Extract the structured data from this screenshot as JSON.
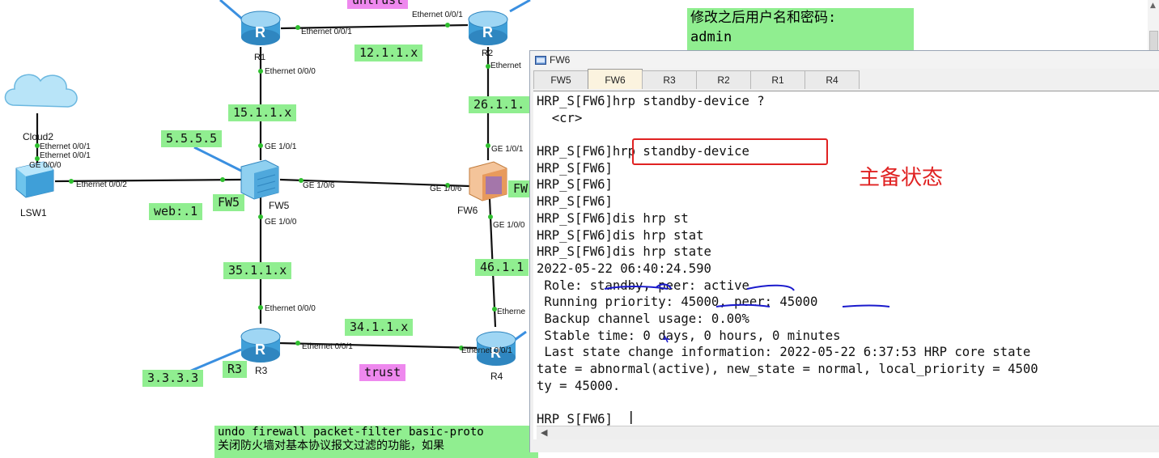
{
  "topology": {
    "devices": {
      "r1": "R1",
      "r2": "R2",
      "r3": "R3",
      "r4": "R4",
      "fw5": "FW5",
      "fw6": "FW6",
      "lsw1": "LSW1",
      "cloud2": "Cloud2"
    },
    "ports": {
      "r1_e001": "Ethernet 0/0/1",
      "r1_e000": "Ethernet 0/0/0",
      "r2_e001": "Ethernet 0/0/1",
      "r2_e": "Ethernet",
      "cloud_e1a": "Ethernet 0/0/1",
      "cloud_e1b": "Ethernet 0/0/1",
      "lsw_ge": "GE 0/0/0",
      "lsw_e2": "Ethernet 0/0/2",
      "fw5_g101": "GE 1/0/1",
      "fw5_g106": "GE 1/0/6",
      "fw5_g100": "GE 1/0/0",
      "fw6_g101": "GE 1/0/1",
      "fw6_g106": "GE 1/0/6",
      "fw6_g100": "GE 1/0/0",
      "r3_e000": "Ethernet 0/0/0",
      "r3_e001": "Ethernet 0/0/1",
      "r4_e001": "Ethernet 0/0/1",
      "r4_e": "Etherne"
    },
    "notes": {
      "untrust": "untrust",
      "net12": "12.1.1.x",
      "net15": "15.1.1.x",
      "net26": "26.1.1.",
      "n5555": "5.5.5.5",
      "fw5": "FW5",
      "fw6": "FW",
      "web": "web:.1",
      "net35": "35.1.1.x",
      "net46": "46.1.1",
      "net34": "34.1.1.x",
      "n3333": "3.3.3.3",
      "r3": "R3",
      "trust": "trust"
    },
    "textbox_line1": "修改之后用户名和密码:",
    "textbox_line2": "admin",
    "bottombox_line1": "undo firewall packet-filter basic-proto",
    "bottombox_line2": "关闭防火墙对基本协议报文过滤的功能，如果"
  },
  "window": {
    "title": "FW6",
    "tabs": [
      "FW5",
      "FW6",
      "R3",
      "R2",
      "R1",
      "R4"
    ],
    "active_tab": "FW6"
  },
  "terminal": {
    "lines": [
      "HRP_S[FW6]hrp standby-device ?",
      "  <cr>",
      "",
      "HRP_S[FW6]hrp standby-device",
      "HRP_S[FW6]",
      "HRP_S[FW6]",
      "HRP_S[FW6]",
      "HRP_S[FW6]dis hrp st",
      "HRP_S[FW6]dis hrp stat",
      "HRP_S[FW6]dis hrp state",
      "2022-05-22 06:40:24.590",
      " Role: standby, peer: active",
      " Running priority: 45000, peer: 45000",
      " Backup channel usage: 0.00%",
      " Stable time: 0 days, 0 hours, 0 minutes",
      " Last state change information: 2022-05-22 6:37:53 HRP core state",
      "tate = abnormal(active), new_state = normal, local_priority = 4500",
      "ty = 45000.",
      "",
      "HRP_S[FW6]"
    ],
    "annotation": "主备状态"
  },
  "colors": {
    "note_green": "#90ee90",
    "note_pink": "#ee88ee",
    "annotation_red": "#e02222",
    "underline_blue": "#1a1acc",
    "link_black": "#111111",
    "link_blue": "#3a8fe0"
  }
}
